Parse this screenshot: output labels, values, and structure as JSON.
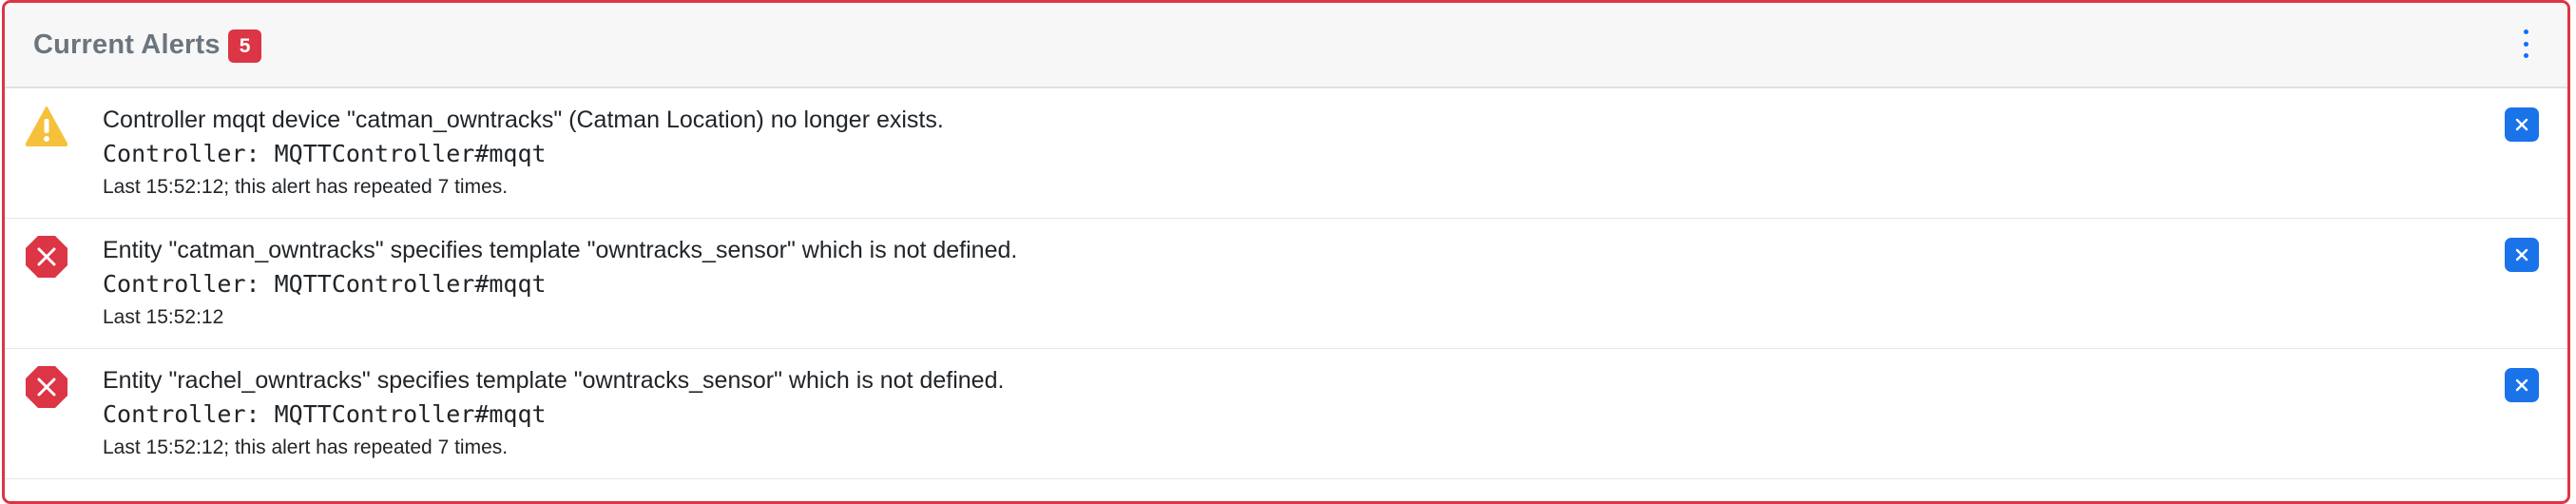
{
  "header": {
    "title": "Current Alerts",
    "count": "5",
    "menu_icon": "kebab-vertical-icon"
  },
  "alerts": [
    {
      "severity": "warning",
      "icon": "warning-triangle-icon",
      "message": "Controller mqqt device \"catman_owntracks\" (Catman Location) no longer exists.",
      "controller": "Controller: MQTTController#mqqt",
      "meta": "Last 15:52:12; this alert has repeated 7 times."
    },
    {
      "severity": "error",
      "icon": "error-octagon-icon",
      "message": "Entity \"catman_owntracks\" specifies template \"owntracks_sensor\" which is not defined.",
      "controller": "Controller: MQTTController#mqqt",
      "meta": "Last 15:52:12"
    },
    {
      "severity": "error",
      "icon": "error-octagon-icon",
      "message": "Entity \"rachel_owntracks\" specifies template \"owntracks_sensor\" which is not defined.",
      "controller": "Controller: MQTTController#mqqt",
      "meta": "Last 15:52:12; this alert has repeated 7 times."
    }
  ],
  "colors": {
    "danger": "#dc3545",
    "warning": "#f5c03b",
    "accent": "#1a73e8",
    "header_bg": "#f7f7f7",
    "title": "#6c757d"
  }
}
